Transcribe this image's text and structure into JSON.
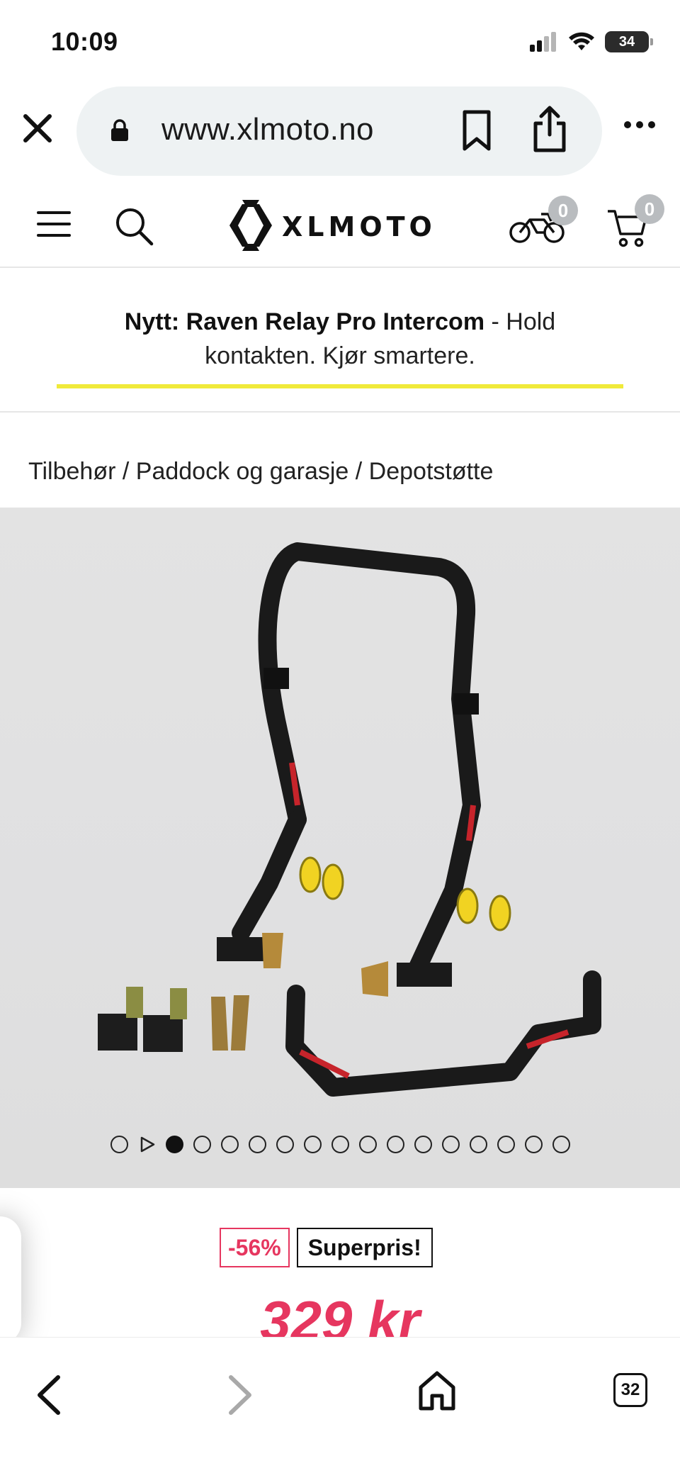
{
  "status_bar": {
    "time": "10:09",
    "battery": "34"
  },
  "browser": {
    "url": "www.xlmoto.no",
    "close_icon": "close-icon",
    "lock_icon": "lock-icon"
  },
  "header": {
    "logo_text": "XLMOTO",
    "garage_count": "0",
    "cart_count": "0"
  },
  "announcement": {
    "bold": "Nytt: Raven Relay Pro Intercom",
    "rest": " - Hold kontakten. Kjør smartere.",
    "underline_color": "#f0ea3a"
  },
  "breadcrumb": {
    "items": [
      "Tilbehør",
      "Paddock og garasje",
      "Depotstøtte"
    ],
    "separator": " / "
  },
  "product": {
    "discount_badge": "-56%",
    "promo_badge": "Superpris!",
    "price": "329 kr",
    "price_color": "#e6365f",
    "carousel": {
      "total_dots": 17,
      "active_index": 1
    }
  },
  "toolbar": {
    "tab_count": "32"
  }
}
